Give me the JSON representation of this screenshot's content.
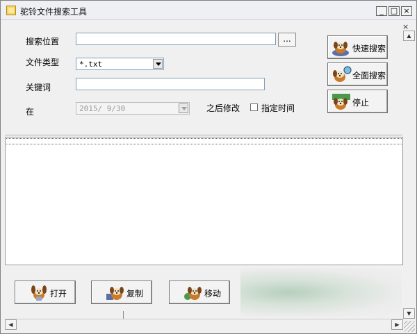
{
  "window": {
    "title": "驼铃文件搜索工具",
    "controls": {
      "minimize": "_",
      "maximize": "□",
      "close": "×",
      "mdi_close": "×"
    }
  },
  "form": {
    "search_location": {
      "label": "搜索位置",
      "value": "",
      "browse_label": "..."
    },
    "file_type": {
      "label": "文件类型",
      "selected": "*.txt"
    },
    "keyword": {
      "label": "关键词",
      "value": ""
    },
    "date": {
      "label": "在",
      "value": "2015/ 9/30",
      "after_label": "之后修改",
      "specify_time_label": "指定时间",
      "specify_time_checked": false
    }
  },
  "actions": {
    "quick_search": "快速搜索",
    "full_search": "全面搜索",
    "stop": "停止"
  },
  "results": {
    "rows": []
  },
  "bottom": {
    "open": "打开",
    "copy": "复制",
    "move": "移动"
  },
  "scrollbar": {
    "up": "▲",
    "down": "▼",
    "left": "◀",
    "right": "▶"
  },
  "colors": {
    "dog_body": "#c97a2a",
    "dog_face": "#f2e2c4",
    "dog_dark": "#3a2a1a"
  }
}
